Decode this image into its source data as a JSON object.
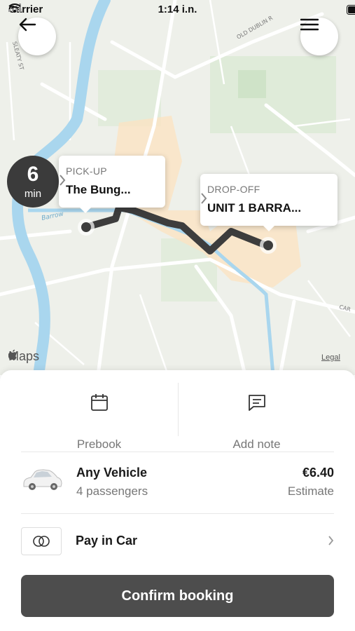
{
  "status": {
    "carrier": "Carrier",
    "time": "1:14 i.n."
  },
  "map": {
    "eta_value": "6",
    "eta_unit": "min",
    "pickup": {
      "label": "PICK-UP",
      "value": "The Bung..."
    },
    "dropoff": {
      "label": "DROP-OFF",
      "value": "UNIT 1 BARRA..."
    },
    "street_labels": [
      "SLEATY ST",
      "OLD DUBLIN R",
      "Barrow",
      "CAR"
    ],
    "attribution": "Maps",
    "legal": "Legal"
  },
  "options": {
    "prebook": "Prebook",
    "add_note": "Add note"
  },
  "vehicle": {
    "name": "Any Vehicle",
    "passengers": "4 passengers",
    "price": "€6.40",
    "estimate": "Estimate"
  },
  "payment": {
    "label": "Pay in Car"
  },
  "confirm_label": "Confirm booking",
  "colors": {
    "route": "#3d3d3d",
    "river": "#a9d6ee",
    "button": "#4d4d4d",
    "eta_bg": "#3b3b3b"
  },
  "icons": [
    "back-arrow-icon",
    "hamburger-menu-icon",
    "calendar-icon",
    "note-icon",
    "car-icon",
    "cash-icon",
    "chevron-right-icon",
    "apple-icon"
  ]
}
